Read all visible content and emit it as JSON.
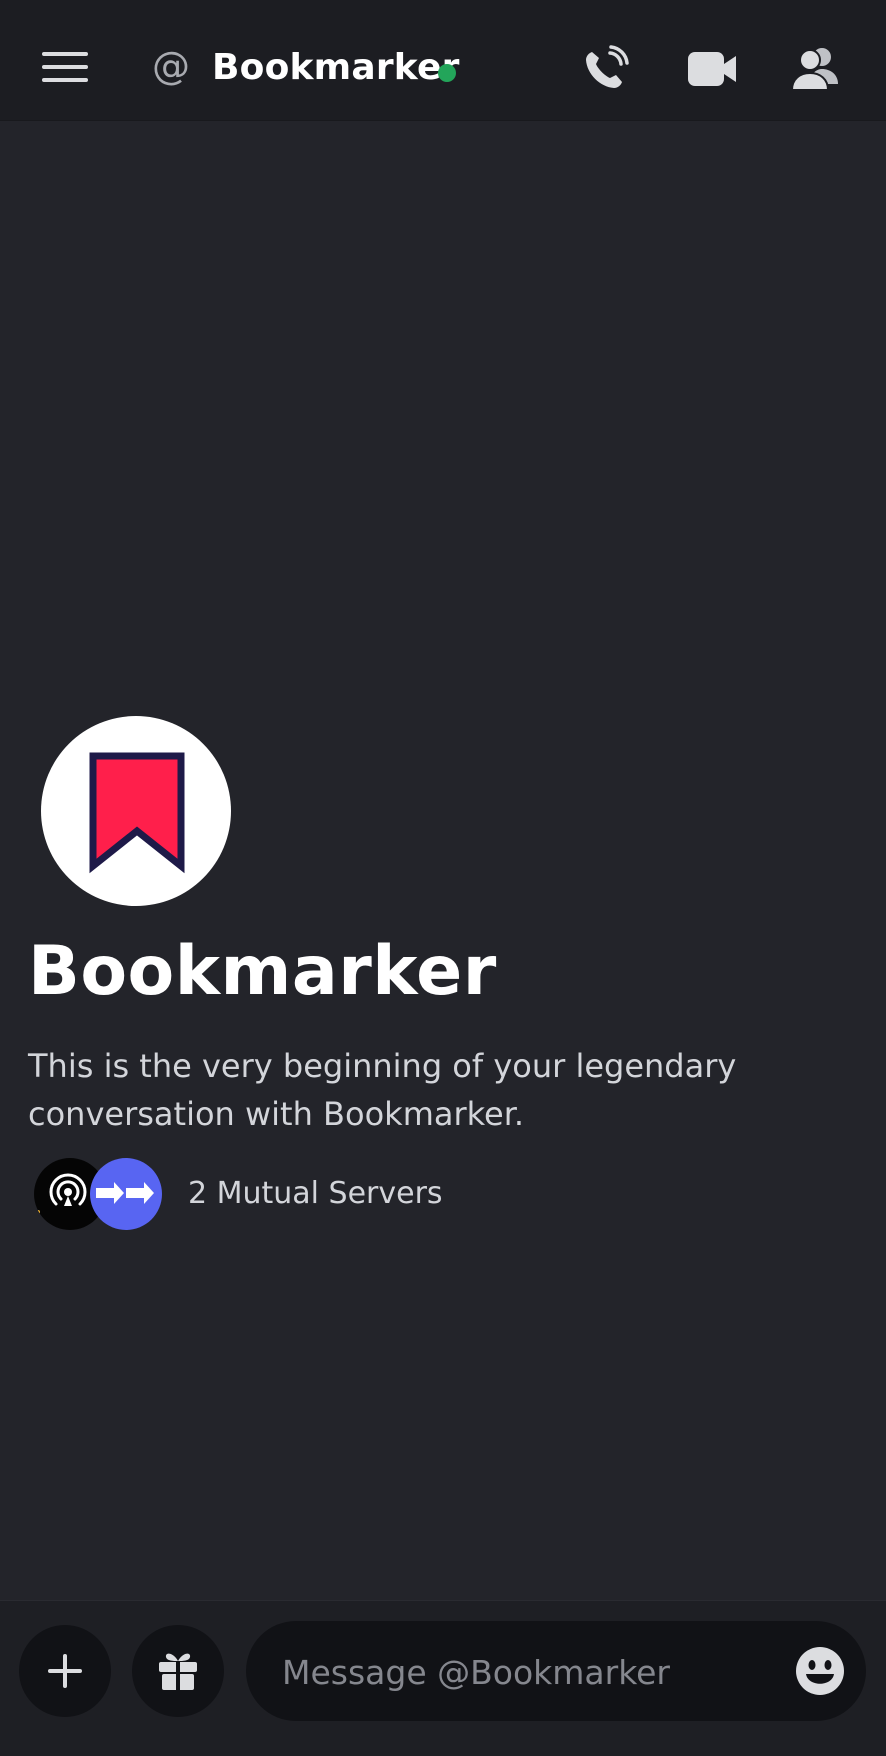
{
  "header": {
    "menu_icon": "hamburger-menu-icon",
    "dm_icon": "at-icon",
    "dm_glyph": "@",
    "title": "Bookmarker",
    "status": "online",
    "status_color": "#23a55a",
    "actions": [
      "phone-call-icon",
      "video-camera-icon",
      "members-icon"
    ]
  },
  "intro": {
    "avatar_icon": "bookmark-icon",
    "avatar_color": "#ff1f4b",
    "name": "Bookmarker",
    "description": "This is the very beginning of your legendary conversation with Bookmarker.",
    "mutual_servers_label": "2 Mutual Servers",
    "server_icons": [
      "podcast-server-icon",
      "arrows-server-icon"
    ]
  },
  "composer": {
    "add_icon": "plus-icon",
    "gift_icon": "gift-icon",
    "placeholder": "Message @Bookmarker",
    "value": "",
    "emoji_icon": "emoji-icon"
  },
  "colors": {
    "background": "#23242a",
    "header": "#1c1d22",
    "accent": "#5865f2",
    "input_bg": "#111216"
  }
}
